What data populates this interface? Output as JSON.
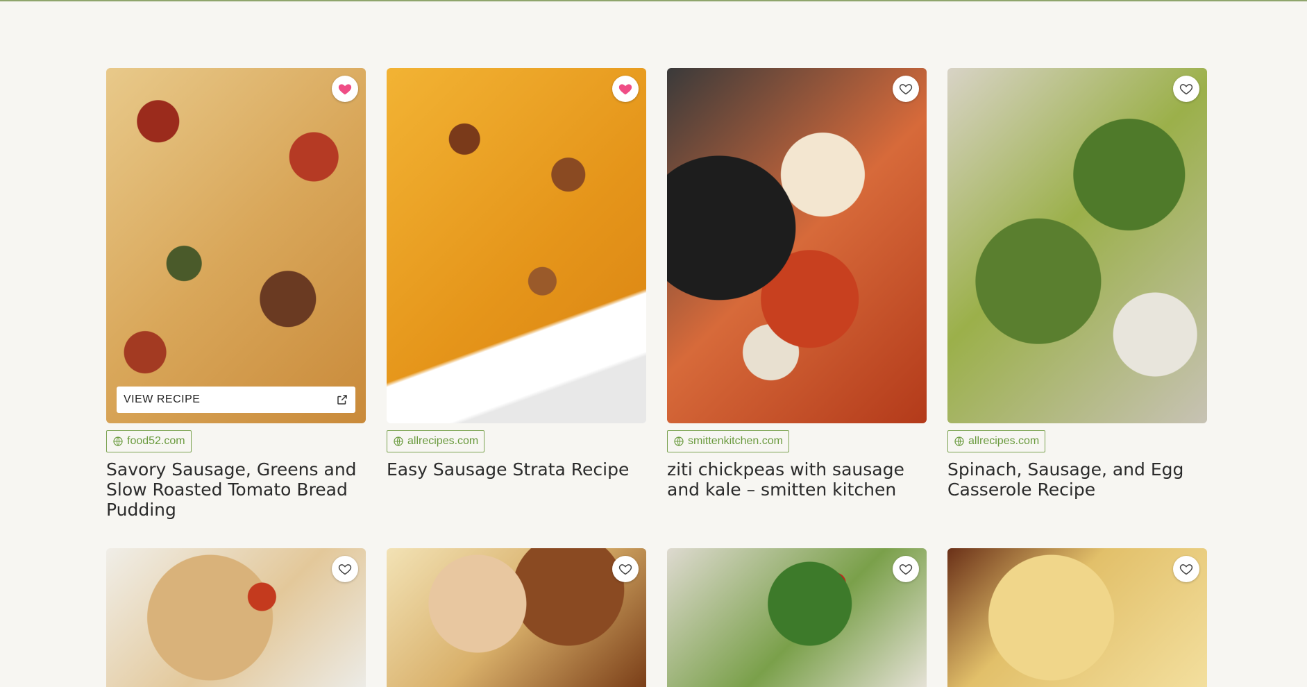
{
  "view_recipe_label": "VIEW RECIPE",
  "colors": {
    "accent": "#7aa24f",
    "favorite_active": "#ef4d86",
    "background": "#f7f6f2"
  },
  "cards": [
    {
      "source": "food52.com",
      "title": "Savory Sausage, Greens and Slow Roasted Tomato Bread Pudding",
      "favorited": true
    },
    {
      "source": "allrecipes.com",
      "title": "Easy Sausage Strata Recipe",
      "favorited": true
    },
    {
      "source": "smittenkitchen.com",
      "title": "ziti chickpeas with sausage and kale – smitten kitchen",
      "favorited": false
    },
    {
      "source": "allrecipes.com",
      "title": "Spinach, Sausage, and Egg Casserole Recipe",
      "favorited": false
    }
  ],
  "second_row_favorites": [
    false,
    false,
    false,
    false
  ]
}
